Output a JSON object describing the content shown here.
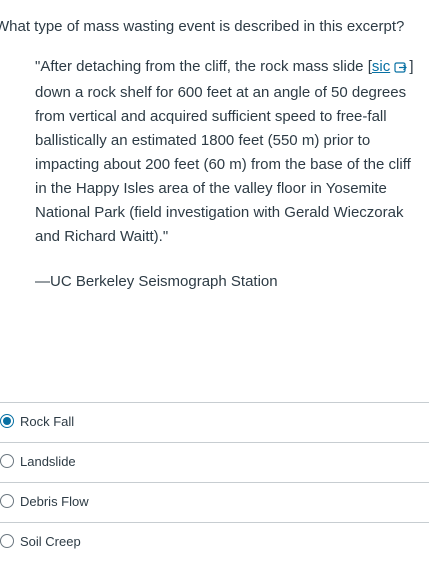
{
  "question": {
    "text": "What type of mass wasting event is described in this excerpt?"
  },
  "quote": {
    "part1": "\"After detaching from the cliff, the rock mass slide [",
    "sic": "sic",
    "part2": "] down a rock shelf for 600 feet at an angle of 50 degrees from vertical and acquired sufficient speed to free-fall ballistically an estimated 1800 feet (550 m) prior to impacting about 200 feet (60 m) from the base of the cliff in the Happy Isles area of the valley floor in Yosemite National Park (field investigation with Gerald Wieczorak and Richard Waitt).\"",
    "attribution": "—UC Berkeley Seismograph Station"
  },
  "answers": [
    {
      "label": "Rock Fall",
      "selected": true
    },
    {
      "label": "Landslide",
      "selected": false
    },
    {
      "label": "Debris Flow",
      "selected": false
    },
    {
      "label": "Soil Creep",
      "selected": false
    }
  ],
  "colors": {
    "text": "#2d3b45",
    "link": "#0770a3",
    "divider": "#c7cdd1"
  }
}
